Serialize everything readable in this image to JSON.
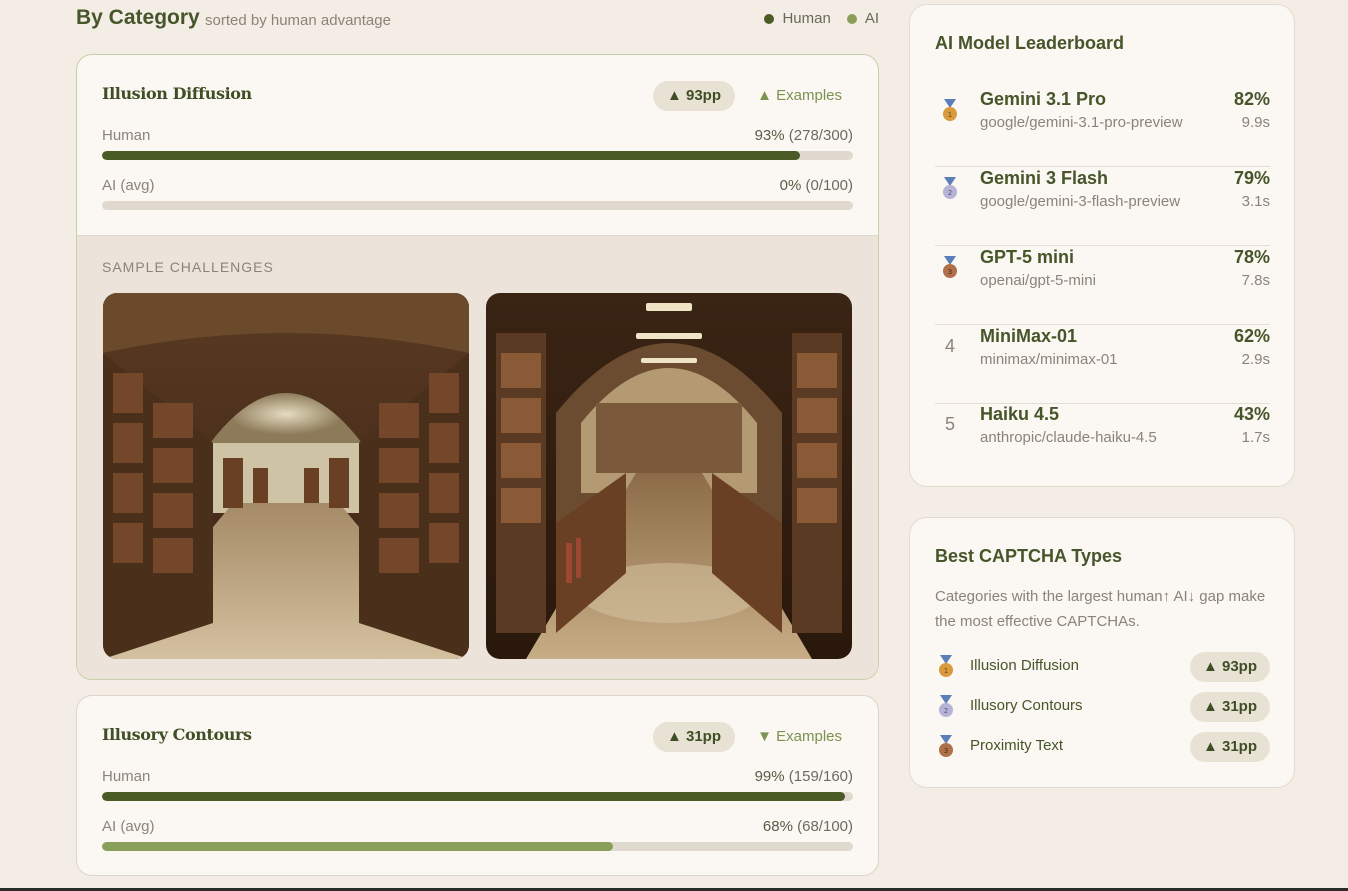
{
  "section": {
    "title": "By Category",
    "subtitle": "sorted by human advantage",
    "legend": [
      {
        "label": "Human",
        "color": "#4b5b26"
      },
      {
        "label": "AI",
        "color": "#8aa05a"
      }
    ]
  },
  "categories": [
    {
      "name": "Illusion Diffusion",
      "gap": "▲ 93pp",
      "examples_label": "▲ Examples",
      "expanded": true,
      "human": {
        "label": "Human",
        "pct": "93%",
        "count": "(278/300)",
        "value": 0.93
      },
      "ai": {
        "label": "AI (avg)",
        "pct": "0%",
        "count": "(0/100)",
        "value": 0.0
      },
      "samples_title": "SAMPLE CHALLENGES"
    },
    {
      "name": "Illusory Contours",
      "gap": "▲ 31pp",
      "examples_label": "▼ Examples",
      "expanded": false,
      "human": {
        "label": "Human",
        "pct": "99%",
        "count": "(159/160)",
        "value": 0.99
      },
      "ai": {
        "label": "AI (avg)",
        "pct": "68%",
        "count": "(68/100)",
        "value": 0.68
      }
    }
  ],
  "colors": {
    "human_bar": "#4b5b26",
    "ai_bar": "#8aa05a",
    "gold": "#d99a3d",
    "silver": "#b6b3d6",
    "bronze": "#b0714a"
  },
  "leaderboard": {
    "title": "AI Model Leaderboard",
    "rows": [
      {
        "rank": "1",
        "medal": "gold-medal-icon",
        "name": "Gemini 3.1 Pro",
        "id": "google/gemini-3.1-pro-preview",
        "score": "82%",
        "time": "9.9s"
      },
      {
        "rank": "2",
        "medal": "silver-medal-icon",
        "name": "Gemini 3 Flash",
        "id": "google/gemini-3-flash-preview",
        "score": "79%",
        "time": "3.1s"
      },
      {
        "rank": "3",
        "medal": "bronze-medal-icon",
        "name": "GPT-5 mini",
        "id": "openai/gpt-5-mini",
        "score": "78%",
        "time": "7.8s"
      },
      {
        "rank": "4",
        "medal": null,
        "name": "MiniMax-01",
        "id": "minimax/minimax-01",
        "score": "62%",
        "time": "2.9s"
      },
      {
        "rank": "5",
        "medal": null,
        "name": "Haiku 4.5",
        "id": "anthropic/claude-haiku-4.5",
        "score": "43%",
        "time": "1.7s"
      }
    ]
  },
  "best": {
    "title": "Best CAPTCHA Types",
    "description": "Categories with the largest human↑ AI↓ gap make the most effective CAPTCHAs.",
    "rows": [
      {
        "name": "Illusion Diffusion",
        "gap": "▲ 93pp",
        "medal": "gold-medal-icon"
      },
      {
        "name": "Illusory Contours",
        "gap": "▲ 31pp",
        "medal": "silver-medal-icon"
      },
      {
        "name": "Proximity Text",
        "gap": "▲ 31pp",
        "medal": "bronze-medal-icon"
      }
    ]
  }
}
